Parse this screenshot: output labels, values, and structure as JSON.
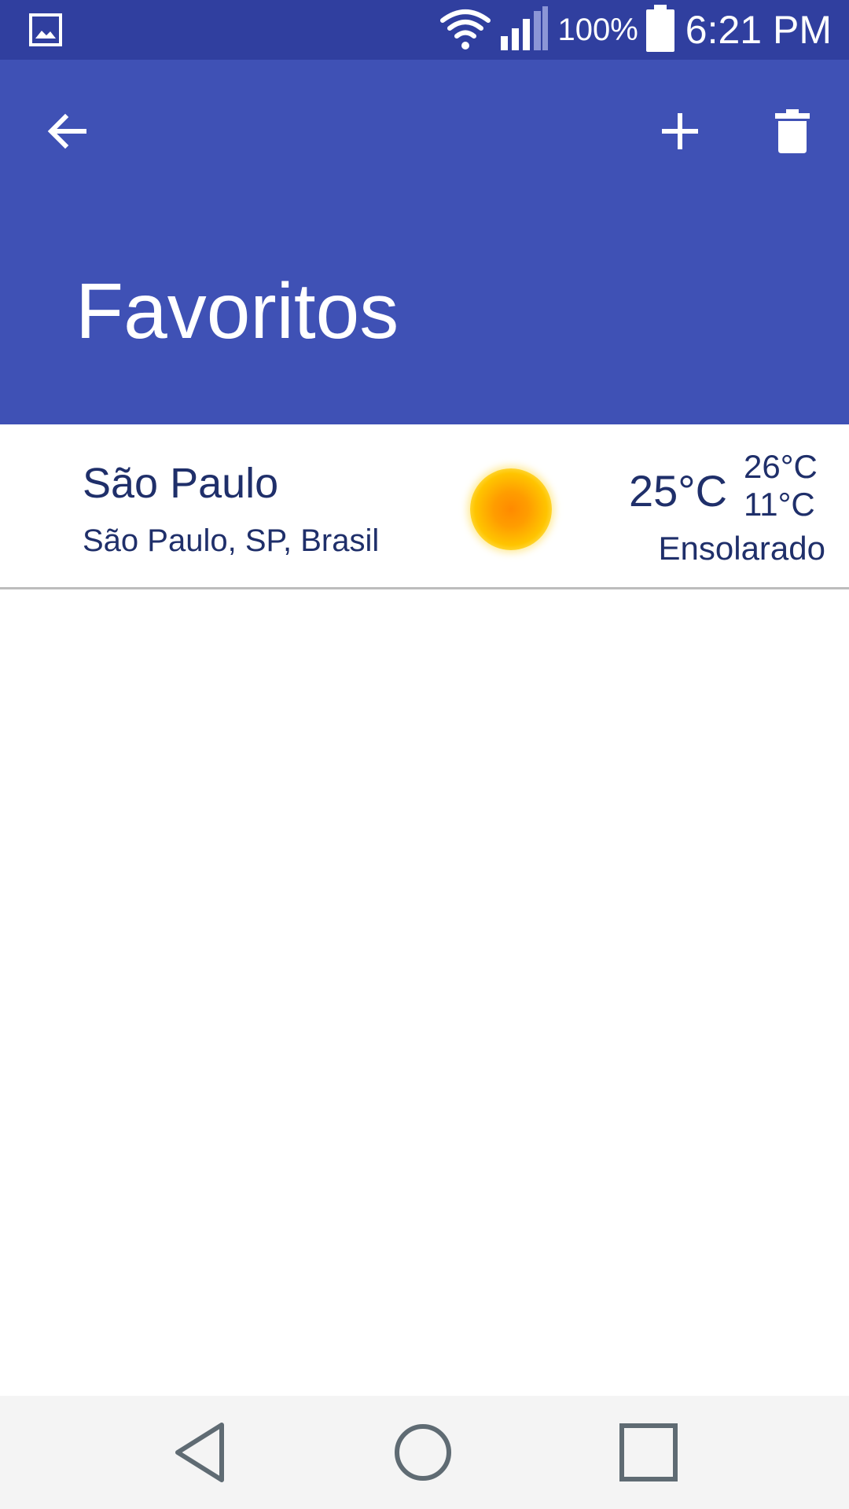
{
  "status_bar": {
    "battery_percent": "100%",
    "time": "6:21 PM",
    "icons": [
      "gallery-notification-icon",
      "wifi-icon",
      "signal-icon",
      "battery-icon"
    ]
  },
  "app_bar": {
    "title": "Favoritos",
    "actions": [
      "back-arrow-icon",
      "add-icon",
      "trash-icon"
    ],
    "colors": {
      "app_bar": "#3F51B5",
      "status_bar": "#303F9F"
    }
  },
  "favorites": [
    {
      "city": "São Paulo",
      "location": "São Paulo, SP, Brasil",
      "temperature": "25°C",
      "max": "26°C",
      "min": "11°C",
      "condition": "Ensolarado",
      "icon": "sun-icon"
    }
  ],
  "nav_bar": {
    "icons": [
      "nav-back-icon",
      "nav-home-icon",
      "nav-recents-icon"
    ]
  }
}
